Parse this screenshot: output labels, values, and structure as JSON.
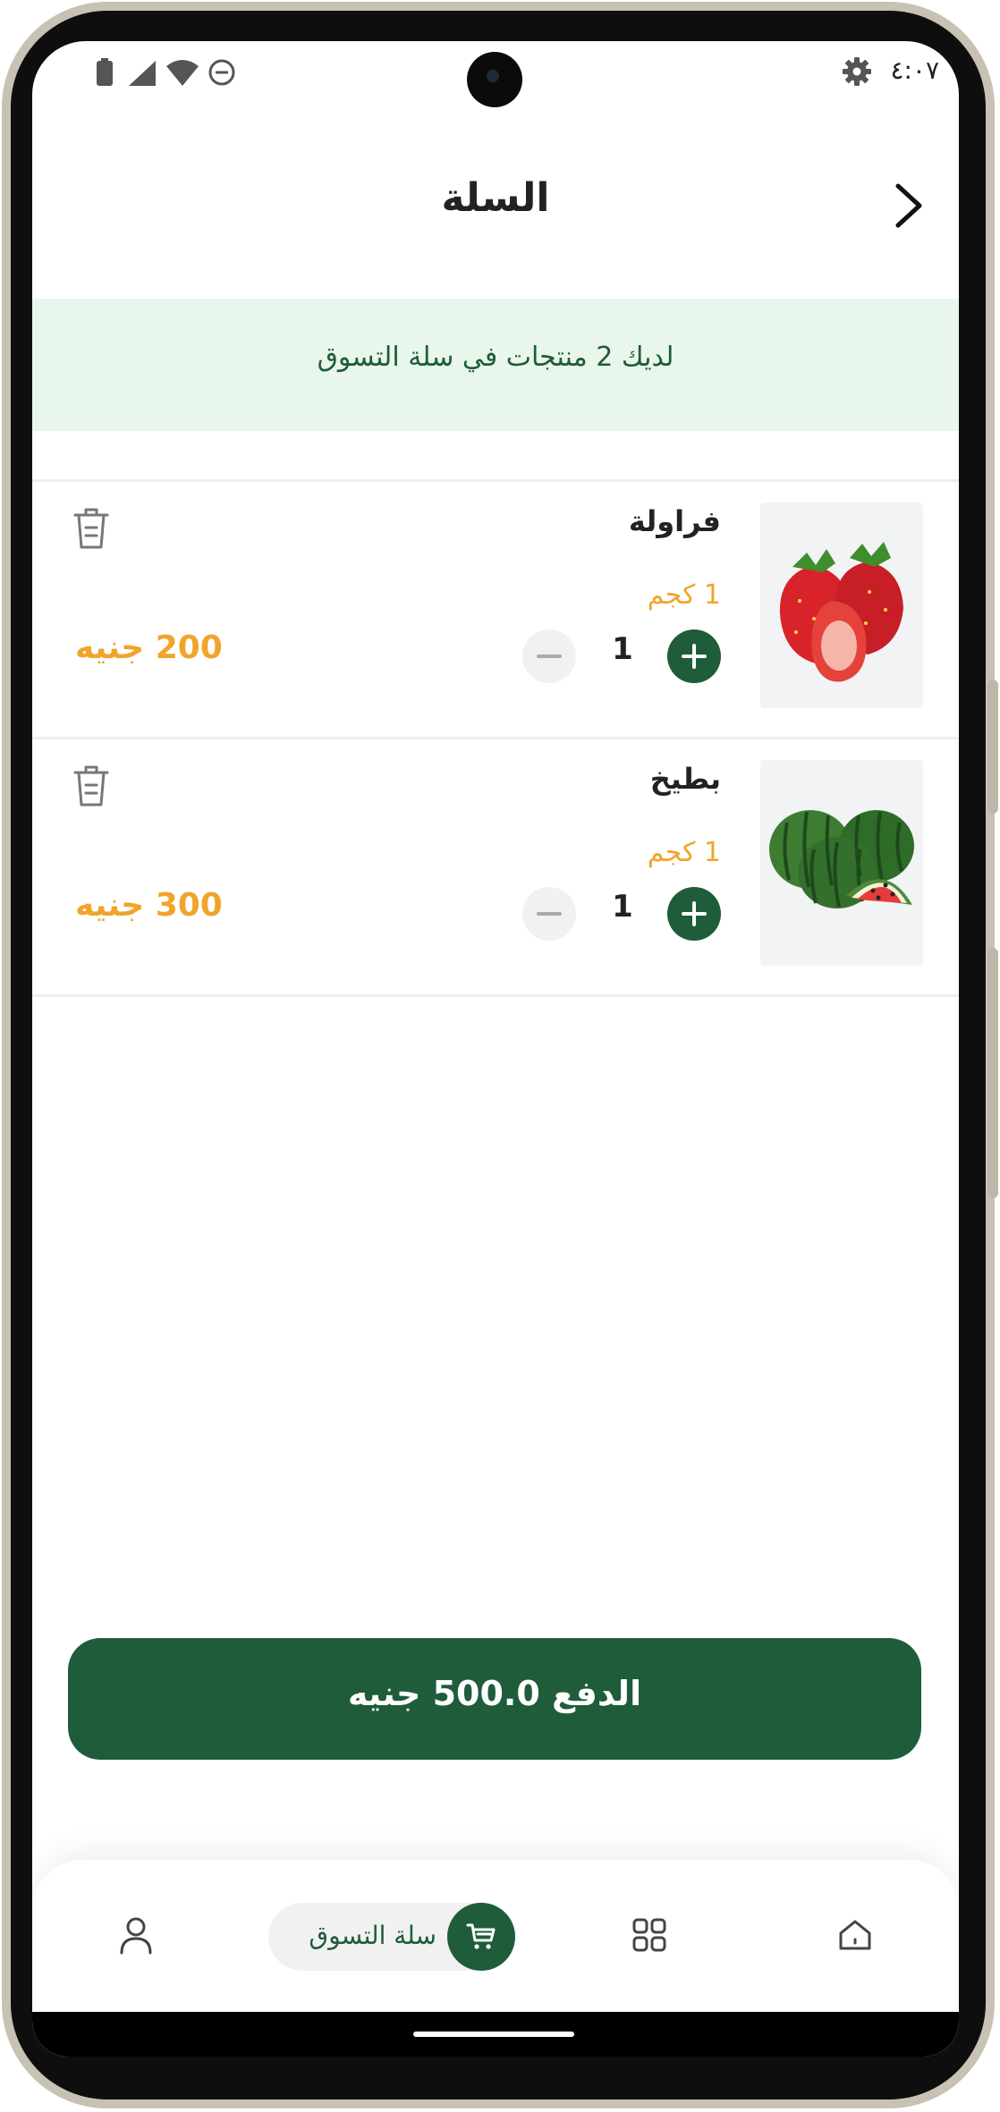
{
  "status_bar": {
    "time": "٤:٠٧"
  },
  "header": {
    "title": "السلة"
  },
  "banner": {
    "message": "لديك 2 منتجات في سلة التسوق"
  },
  "cart": {
    "items": [
      {
        "name": "فراولة",
        "weight": "1 كجم",
        "quantity": "1",
        "price": "200 جنيه",
        "image_icon": "strawberry-image"
      },
      {
        "name": "بطيخ",
        "weight": "1 كجم",
        "quantity": "1",
        "price": "300 جنيه",
        "image_icon": "watermelon-image"
      }
    ]
  },
  "checkout": {
    "label": "الدفع 500.0 جنيه"
  },
  "bottom_nav": {
    "items": [
      {
        "icon": "user-icon"
      },
      {
        "icon": "cart-icon",
        "label": "سلة التسوق",
        "active": true
      },
      {
        "icon": "grid-icon"
      },
      {
        "icon": "home-icon"
      }
    ]
  },
  "colors": {
    "primary": "#1e5c3a",
    "accent": "#f0a52a",
    "banner_bg": "#e9f6ec"
  }
}
